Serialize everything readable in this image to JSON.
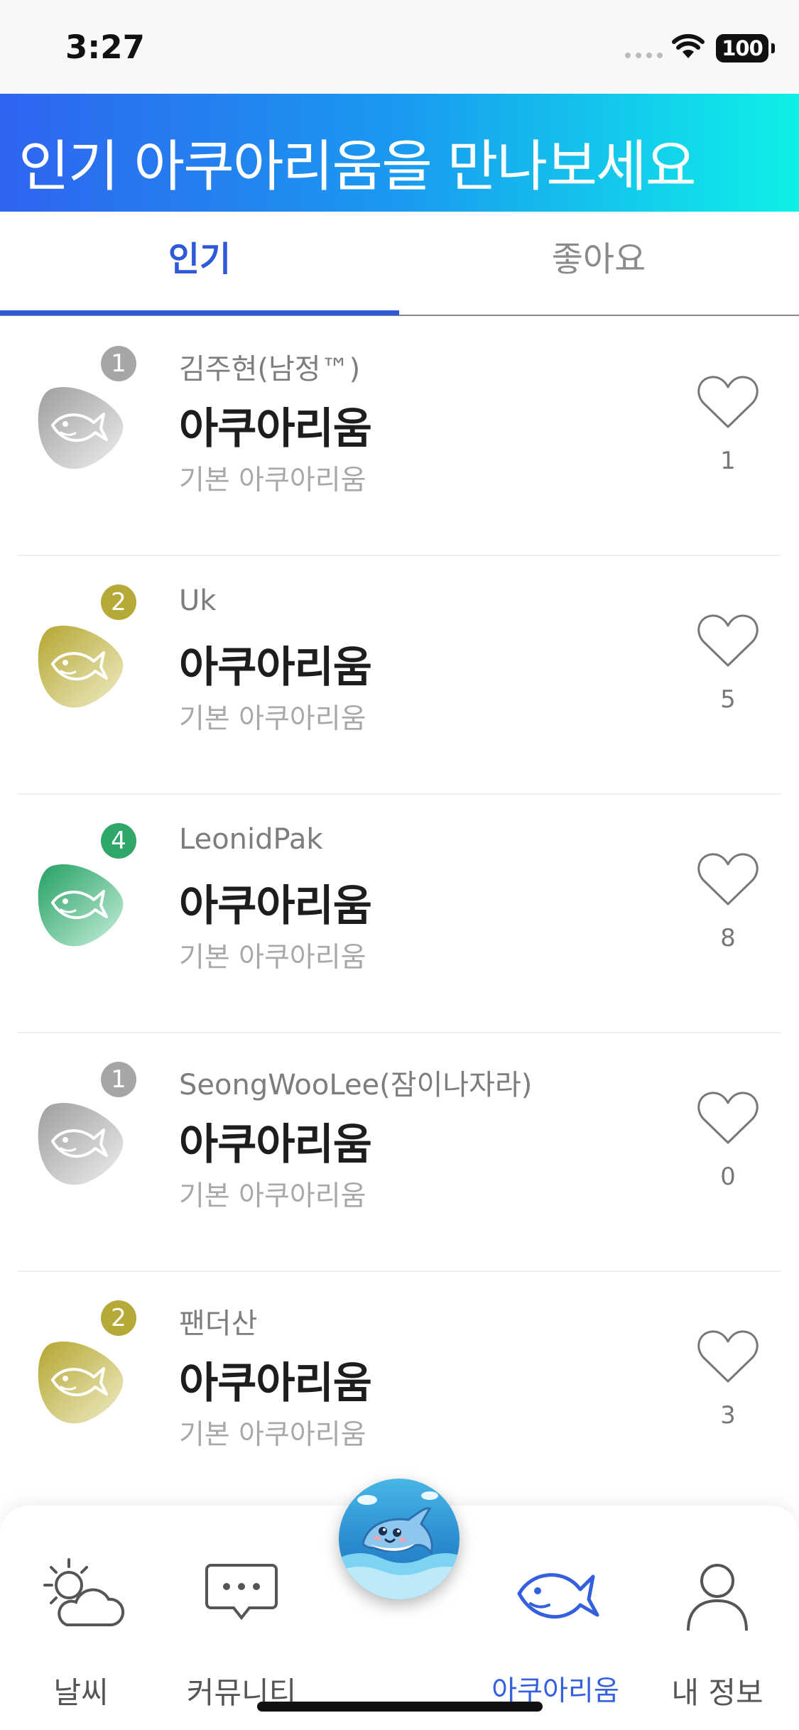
{
  "status_bar": {
    "time": "3:27",
    "battery": "100"
  },
  "banner": {
    "title": "인기 아쿠아리움을 만나보세요"
  },
  "tabs": [
    {
      "label": "인기",
      "active": true
    },
    {
      "label": "좋아요",
      "active": false
    }
  ],
  "list": [
    {
      "rank": "1",
      "rank_color": "#a6a6a6",
      "avatar_colors": [
        "#9e9e9e",
        "#eeeeee"
      ],
      "owner": "김주현(남정™)",
      "title": "아쿠아리움",
      "subtitle": "기본 아쿠아리움",
      "likes": "1"
    },
    {
      "rank": "2",
      "rank_color": "#b5a938",
      "avatar_colors": [
        "#b3a630",
        "#f0edc8"
      ],
      "owner": "Uk",
      "title": "아쿠아리움",
      "subtitle": "기본 아쿠아리움",
      "likes": "5"
    },
    {
      "rank": "4",
      "rank_color": "#2fa769",
      "avatar_colors": [
        "#23a062",
        "#c9efdb"
      ],
      "owner": "LeonidPak",
      "title": "아쿠아리움",
      "subtitle": "기본 아쿠아리움",
      "likes": "8"
    },
    {
      "rank": "1",
      "rank_color": "#a6a6a6",
      "avatar_colors": [
        "#9e9e9e",
        "#eeeeee"
      ],
      "owner": "SeongWooLee(잠이나자라)",
      "title": "아쿠아리움",
      "subtitle": "기본 아쿠아리움",
      "likes": "0"
    },
    {
      "rank": "2",
      "rank_color": "#b5a938",
      "avatar_colors": [
        "#b3a630",
        "#f0edc8"
      ],
      "owner": "팬더산",
      "title": "아쿠아리움",
      "subtitle": "기본 아쿠아리움",
      "likes": "3"
    }
  ],
  "tab_bar": {
    "items": [
      {
        "label": "날씨",
        "icon": "weather-icon"
      },
      {
        "label": "커뮤니티",
        "icon": "chat-bubble-icon"
      },
      {
        "label": "아쿠아리움",
        "icon": "fish-icon",
        "active": true
      },
      {
        "label": "내 정보",
        "icon": "person-icon"
      }
    ],
    "center_button_icon": "dolphin-icon"
  },
  "colors": {
    "accent": "#2e59d9",
    "banner_start": "#2f64f0",
    "banner_end": "#0ef0e8"
  }
}
